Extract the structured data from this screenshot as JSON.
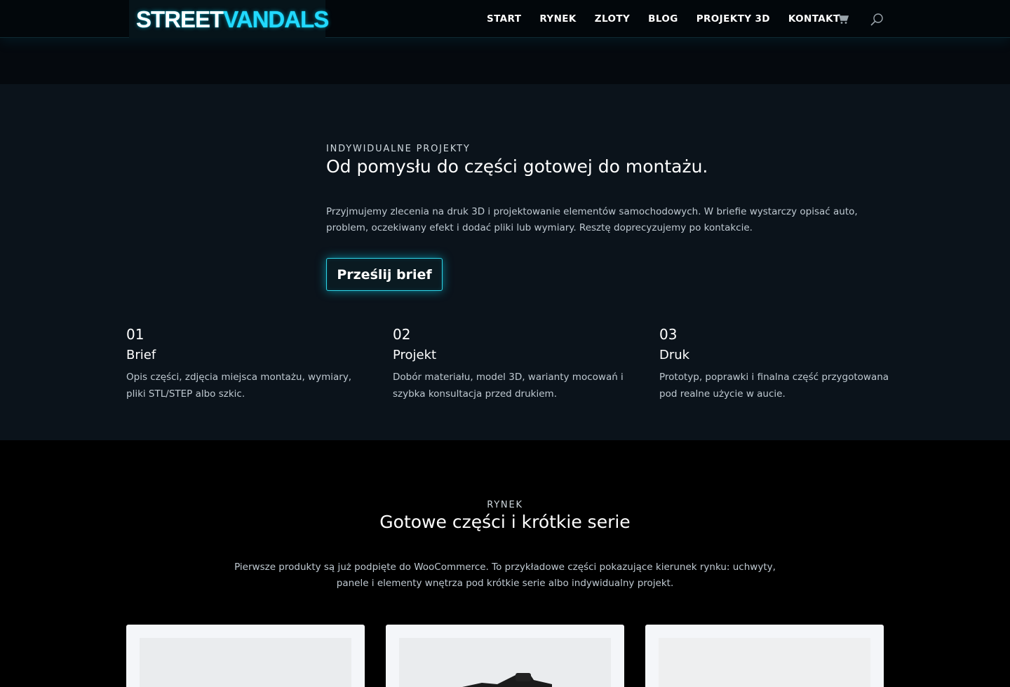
{
  "header": {
    "logo_white": "STREET",
    "logo_cyan": "VANDALS",
    "nav": [
      "START",
      "RYNEK",
      "ZLOTY",
      "BLOG",
      "PROJEKTY 3D",
      "KONTAKT"
    ],
    "cart_icon": "cart-icon",
    "search_icon": "search-icon"
  },
  "projects": {
    "eyebrow": "INDYWIDUALNE PROJEKTY",
    "title": "Od pomysłu do części gotowej do montażu.",
    "description": "Przyjmujemy zlecenia na druk 3D i projektowanie elementów samochodowych. W briefie wystarczy opisać auto, problem, oczekiwany efekt i dodać pliki lub wymiary. Resztę doprecyzujemy po kontakcie.",
    "button": "Prześlij brief",
    "steps": [
      {
        "num": "01",
        "title": "Brief",
        "desc": "Opis części, zdjęcia miejsca montażu, wymiary, pliki STL/STEP albo szkic."
      },
      {
        "num": "02",
        "title": "Projekt",
        "desc": "Dobór materiału, model 3D, warianty mocowań i szybka konsultacja przed drukiem."
      },
      {
        "num": "03",
        "title": "Druk",
        "desc": "Prototyp, poprawki i finalna część przygotowana pod realne użycie w aucie."
      }
    ]
  },
  "market": {
    "eyebrow": "RYNEK",
    "title": "Gotowe części i krótkie serie",
    "description": "Pierwsze produkty są już podpięte do WooCommerce. To przykładowe części pokazujące kierunek rynku: uchwyty, panele i elementy wnętrza pod krótkie serie albo indywidualny projekt."
  },
  "colors": {
    "accent": "#22d9ff",
    "section_bg": "#0b131b",
    "card_bg": "#f4f6f9"
  }
}
